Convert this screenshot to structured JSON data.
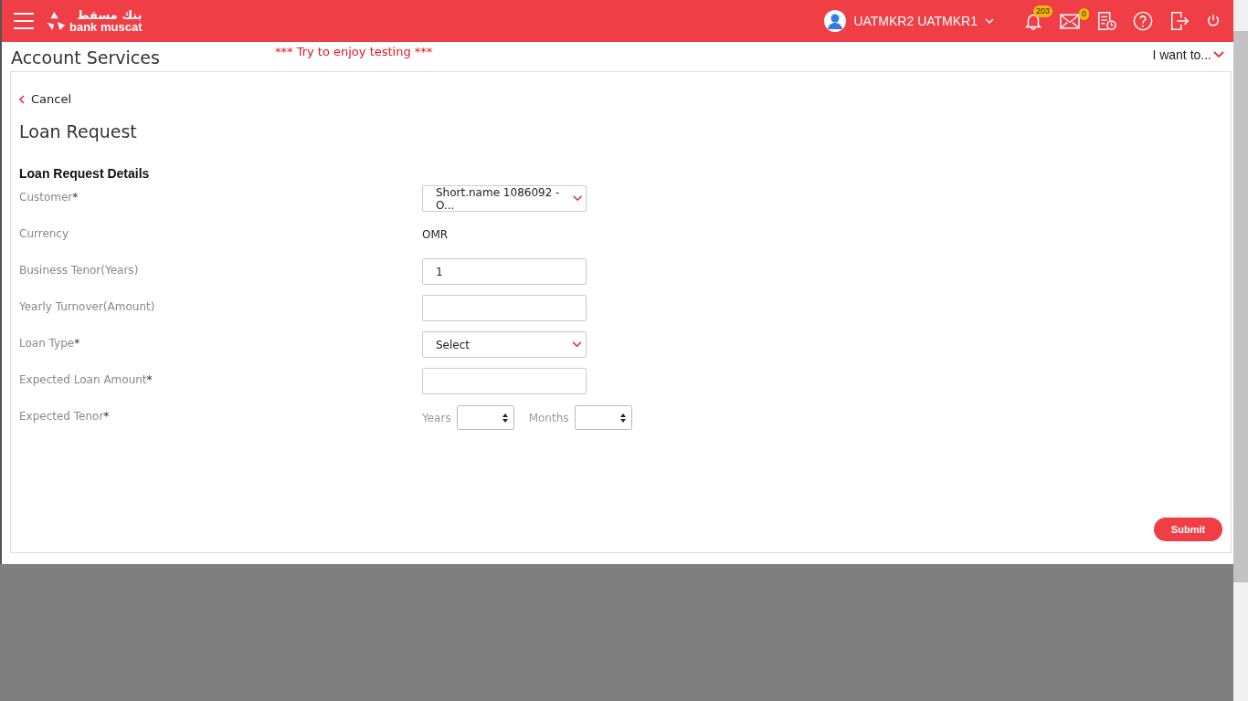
{
  "header": {
    "logo_arabic": "بنك مسقط",
    "logo_text": "bank muscat",
    "user": "UATMKR2 UATMKR1",
    "notifications_badge": "203",
    "messages_badge": "0"
  },
  "page": {
    "title": "Account Services",
    "notice": "*** Try to enjoy testing ***",
    "menu": "I want to..."
  },
  "card": {
    "back": "Cancel",
    "title": "Loan Request",
    "section": "Loan Request Details",
    "fields": [
      {
        "kind": "select",
        "label": "Customer",
        "mark": "*",
        "value": "Short.name 1086092 - O..."
      },
      {
        "kind": "text",
        "label": "Currency",
        "value": "OMR"
      },
      {
        "kind": "input",
        "label": "Business Tenor(Years)",
        "value": "1"
      },
      {
        "kind": "input",
        "label": "Yearly Turnover(Amount)"
      },
      {
        "kind": "select",
        "label": "Loan Type",
        "mark": "*",
        "value": "Select"
      },
      {
        "kind": "input",
        "label": "Expected Loan Amount",
        "mark": "*"
      },
      {
        "kind": "tenor",
        "label": "Expected Tenor",
        "mark": "*",
        "parts": [
          "Years",
          "Months"
        ]
      }
    ],
    "submit": "Submit"
  }
}
